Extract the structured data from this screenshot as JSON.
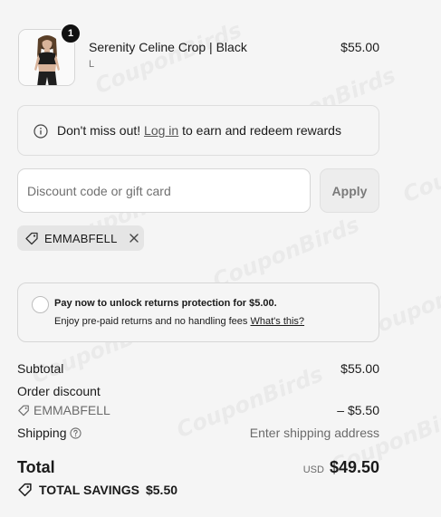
{
  "product": {
    "quantity": "1",
    "name": "Serenity Celine Crop | Black",
    "variant": "L",
    "price": "$55.00"
  },
  "rewards": {
    "prefix": "Don't miss out!",
    "link": "Log in",
    "suffix": "to earn and redeem rewards"
  },
  "discount": {
    "placeholder": "Discount code or gift card",
    "apply_label": "Apply",
    "applied_code": "EMMABFELL"
  },
  "protection": {
    "title": "Pay now to unlock returns protection for $5.00.",
    "body": "Enjoy pre-paid returns and no handling fees",
    "link": "What's this?"
  },
  "summary": {
    "subtotal_label": "Subtotal",
    "subtotal_value": "$55.00",
    "order_discount_label": "Order discount",
    "discount_code": "EMMABFELL",
    "discount_value": "– $5.50",
    "shipping_label": "Shipping",
    "shipping_value": "Enter shipping address",
    "total_label": "Total",
    "currency": "USD",
    "total_value": "$49.50",
    "savings_label": "TOTAL SAVINGS",
    "savings_value": "$5.50"
  },
  "watermark": "CouponBirds"
}
